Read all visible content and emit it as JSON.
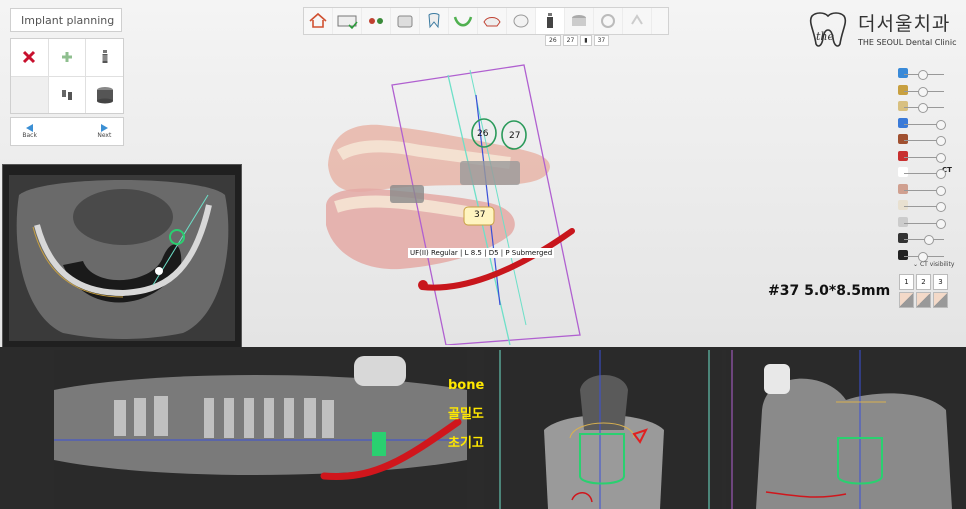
{
  "app": {
    "panel_title": "Implant planning",
    "nav": {
      "back_label": "Back",
      "next_label": "Next"
    }
  },
  "tools": [
    {
      "name": "delete-implant",
      "icon": "red-x-icon"
    },
    {
      "name": "add-implant",
      "icon": "green-plus-icon"
    },
    {
      "name": "implant-library",
      "icon": "implant-icon"
    },
    {
      "name": "empty",
      "icon": ""
    },
    {
      "name": "abutment",
      "icon": "abutment-icon"
    },
    {
      "name": "sleeve",
      "icon": "sleeve-icon"
    }
  ],
  "toolbar": {
    "items": [
      "home-icon",
      "scan-icon",
      "align-icon",
      "model-icon",
      "tooth-icon",
      "arch-icon",
      "crown-icon",
      "tooth-shape-icon",
      "implant-step-icon",
      "sleeve-step-icon",
      "guide-icon",
      "export-icon"
    ],
    "active_index": 8
  },
  "tooth_tabs": [
    "26",
    "27",
    "▮",
    "37"
  ],
  "logo": {
    "name": "더서울치과",
    "sub": "THE SEOUL Dental Clinic"
  },
  "view_3d": {
    "implant_label": "UF(II) Regular | L 8.5 | D5 | P Submerged",
    "tooth_tags": [
      "26",
      "27",
      "37"
    ]
  },
  "right_panel": {
    "slider_icons": [
      "pin-icon",
      "model-icon",
      "crown-icon",
      "tooth-icon",
      "sleeve-icon",
      "canal-icon",
      "ct-icon",
      "crown2-icon",
      "gum-icon",
      "implant-icon",
      "sun-icon",
      "contrast-icon"
    ],
    "slider_values": [
      0.45,
      0.45,
      0.45,
      0.9,
      0.9,
      0.9,
      0.9,
      0.9,
      0.9,
      0.9,
      0.6,
      0.45
    ],
    "ct_label": "CT",
    "ct_visibility_label": "CT visibility",
    "view_buttons": [
      "1",
      "2",
      "3",
      "",
      "",
      ""
    ]
  },
  "implant_size": "#37 5.0*8.5mm",
  "annotations": {
    "line1": "bone확인",
    "line2": "골밀도확인",
    "line3": "초기고정확인"
  }
}
